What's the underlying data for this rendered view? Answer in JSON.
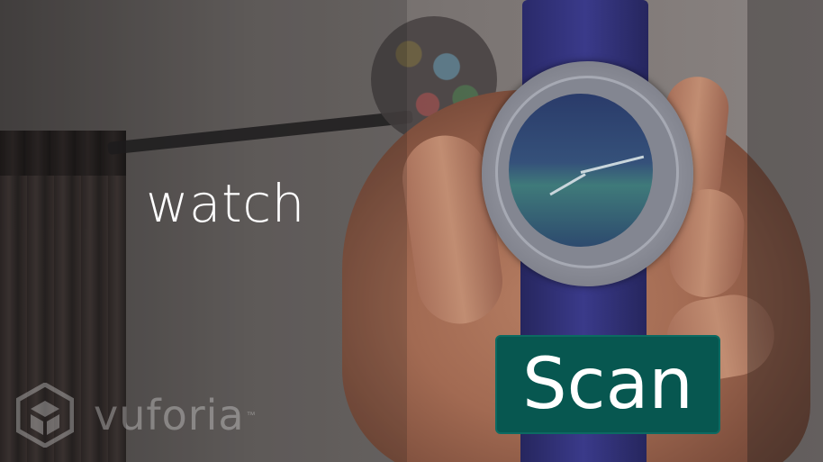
{
  "camera_view": {
    "detected_label": "watch",
    "scan_button_label": "Scan",
    "watermark": {
      "brand": "vuforia",
      "trademark": "™"
    }
  },
  "colors": {
    "scan_button_bg": "#075750",
    "label_text": "#ffffff"
  }
}
